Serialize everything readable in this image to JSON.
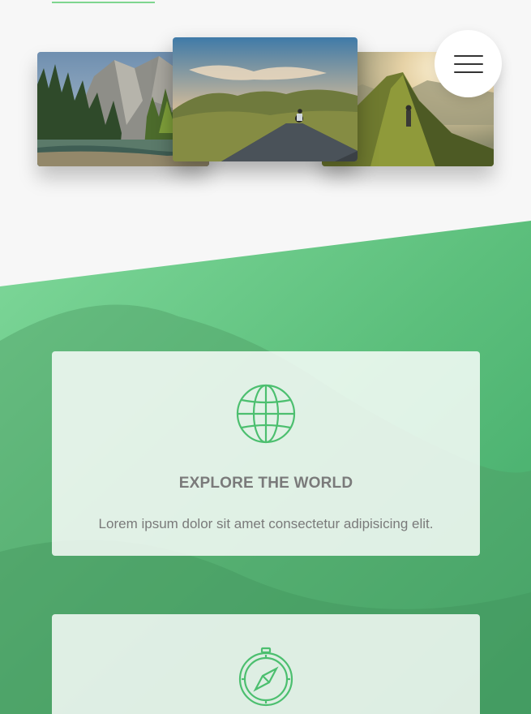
{
  "menu": {
    "icon": "hamburger-menu-icon"
  },
  "gallery": {
    "photos": [
      {
        "subject": "mountain valley with pine trees and river"
      },
      {
        "subject": "cyclist on road through green hills"
      },
      {
        "subject": "person on mountain ridge at sunset"
      }
    ]
  },
  "colors": {
    "accent_green": "#5cc27a",
    "icon_green": "#4cbf6f",
    "text_gray": "#7a7a7a"
  },
  "features": [
    {
      "icon": "globe-icon",
      "title": "EXPLORE THE WORLD",
      "text": "Lorem ipsum dolor sit amet consectetur adipisicing elit."
    },
    {
      "icon": "compass-icon"
    }
  ]
}
